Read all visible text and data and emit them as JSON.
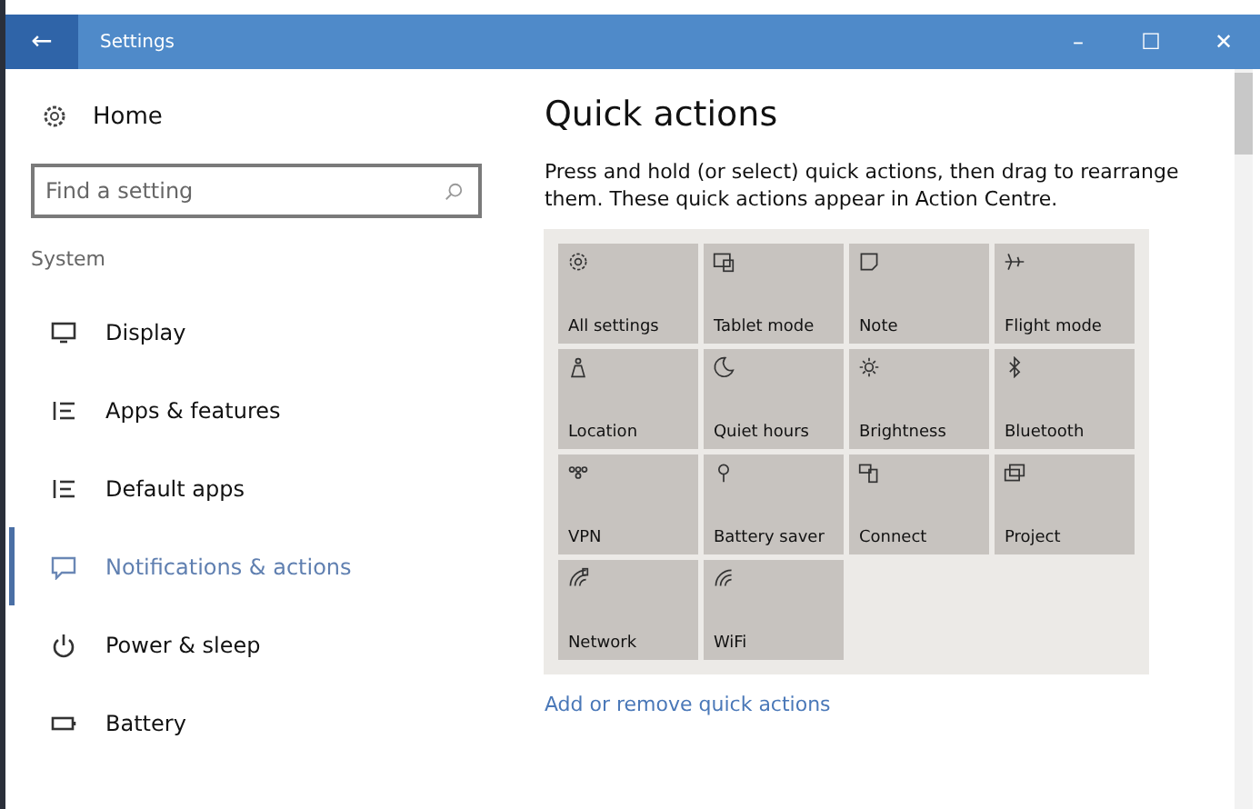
{
  "window": {
    "back": "←",
    "title": "Settings",
    "minimize": "–",
    "maximize": "☐",
    "close": "✕"
  },
  "sidebar": {
    "home": "Home",
    "search": {
      "placeholder": "Find a setting"
    },
    "section": "System",
    "items": [
      {
        "label": "Display",
        "selected": false
      },
      {
        "label": "Apps & features",
        "selected": false
      },
      {
        "label": "Default apps",
        "selected": false
      },
      {
        "label": "Notifications & actions",
        "selected": true
      },
      {
        "label": "Power & sleep",
        "selected": false
      },
      {
        "label": "Battery",
        "selected": false
      }
    ]
  },
  "content": {
    "heading": "Quick actions",
    "description": "Press and hold (or select) quick actions, then drag to rearrange them. These quick actions appear in Action Centre.",
    "tiles": [
      {
        "label": "All settings"
      },
      {
        "label": "Tablet mode"
      },
      {
        "label": "Note"
      },
      {
        "label": "Flight mode"
      },
      {
        "label": "Location"
      },
      {
        "label": "Quiet hours"
      },
      {
        "label": "Brightness"
      },
      {
        "label": "Bluetooth"
      },
      {
        "label": "VPN"
      },
      {
        "label": "Battery saver"
      },
      {
        "label": "Connect"
      },
      {
        "label": "Project"
      },
      {
        "label": "Network"
      },
      {
        "label": "WiFi"
      }
    ],
    "link": "Add or remove quick actions"
  }
}
